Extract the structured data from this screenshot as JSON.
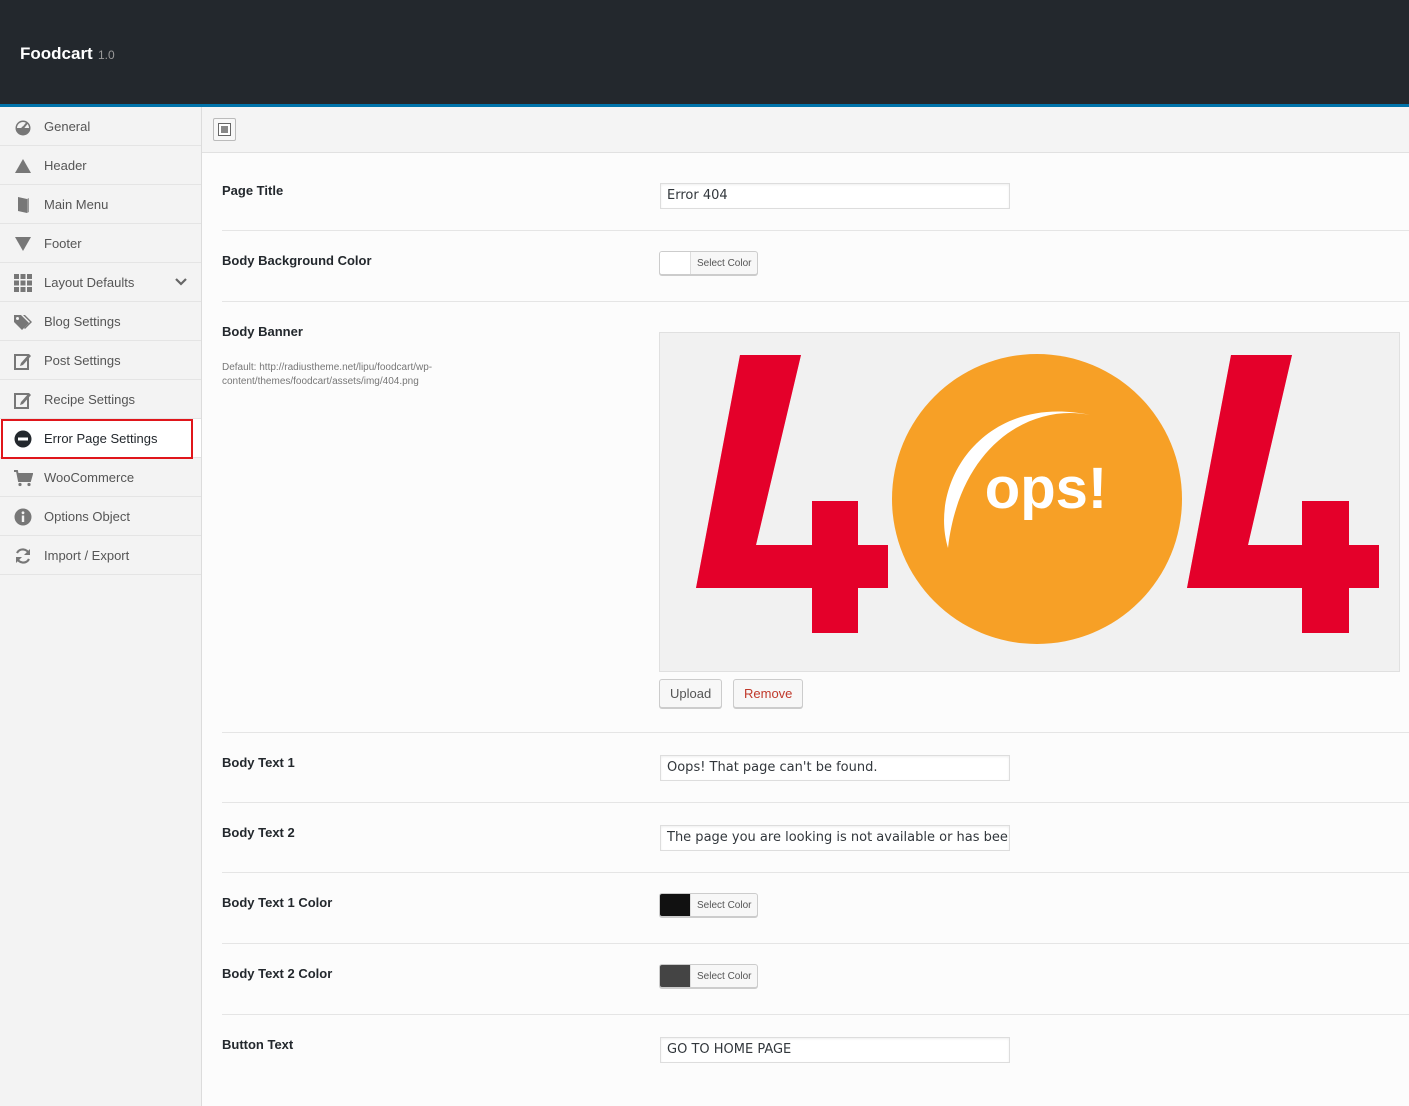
{
  "app": {
    "title": "Foodcart",
    "version": "1.0"
  },
  "sidebar": {
    "items": [
      {
        "label": "General",
        "icon": "dashboard-icon"
      },
      {
        "label": "Header",
        "icon": "triangle-up-icon"
      },
      {
        "label": "Main Menu",
        "icon": "book-icon"
      },
      {
        "label": "Footer",
        "icon": "triangle-down-icon"
      },
      {
        "label": "Layout Defaults",
        "icon": "grid-icon"
      },
      {
        "label": "Blog Settings",
        "icon": "tags-icon"
      },
      {
        "label": "Post Settings",
        "icon": "edit-icon"
      },
      {
        "label": "Recipe Settings",
        "icon": "edit-icon"
      },
      {
        "label": "Error Page Settings",
        "icon": "minus-circle-icon"
      },
      {
        "label": "WooCommerce",
        "icon": "cart-icon"
      },
      {
        "label": "Options Object",
        "icon": "info-icon"
      },
      {
        "label": "Import / Export",
        "icon": "refresh-icon"
      }
    ],
    "active_item": "Error Page Settings"
  },
  "fields": {
    "page_title": {
      "label": "Page Title",
      "value": "Error 404"
    },
    "body_bg_color": {
      "label": "Body Background Color",
      "button": "Select Color",
      "color": "#ffffff"
    },
    "body_banner": {
      "label": "Body Banner",
      "description": "Default: http://radiustheme.net/lipu/foodcart/wp-content/themes/foodcart/assets/img/404.png",
      "image_text": {
        "left": "4",
        "center": "ops!",
        "right": "4"
      },
      "upload_label": "Upload",
      "remove_label": "Remove"
    },
    "body_text_1": {
      "label": "Body Text 1",
      "value": "Oops! That page can't be found."
    },
    "body_text_2": {
      "label": "Body Text 2",
      "value": "The page you are looking is not available or has been r"
    },
    "body_text_1_color": {
      "label": "Body Text 1 Color",
      "button": "Select Color",
      "color": "#111111"
    },
    "body_text_2_color": {
      "label": "Body Text 2 Color",
      "button": "Select Color",
      "color": "#444444"
    },
    "button_text": {
      "label": "Button Text",
      "value": "GO TO HOME PAGE"
    }
  },
  "colors": {
    "topbar": "#23282d",
    "accent": "#0073aa",
    "banner_red": "#e4002b",
    "banner_orange": "#f7a026",
    "remove_red": "#a00"
  }
}
